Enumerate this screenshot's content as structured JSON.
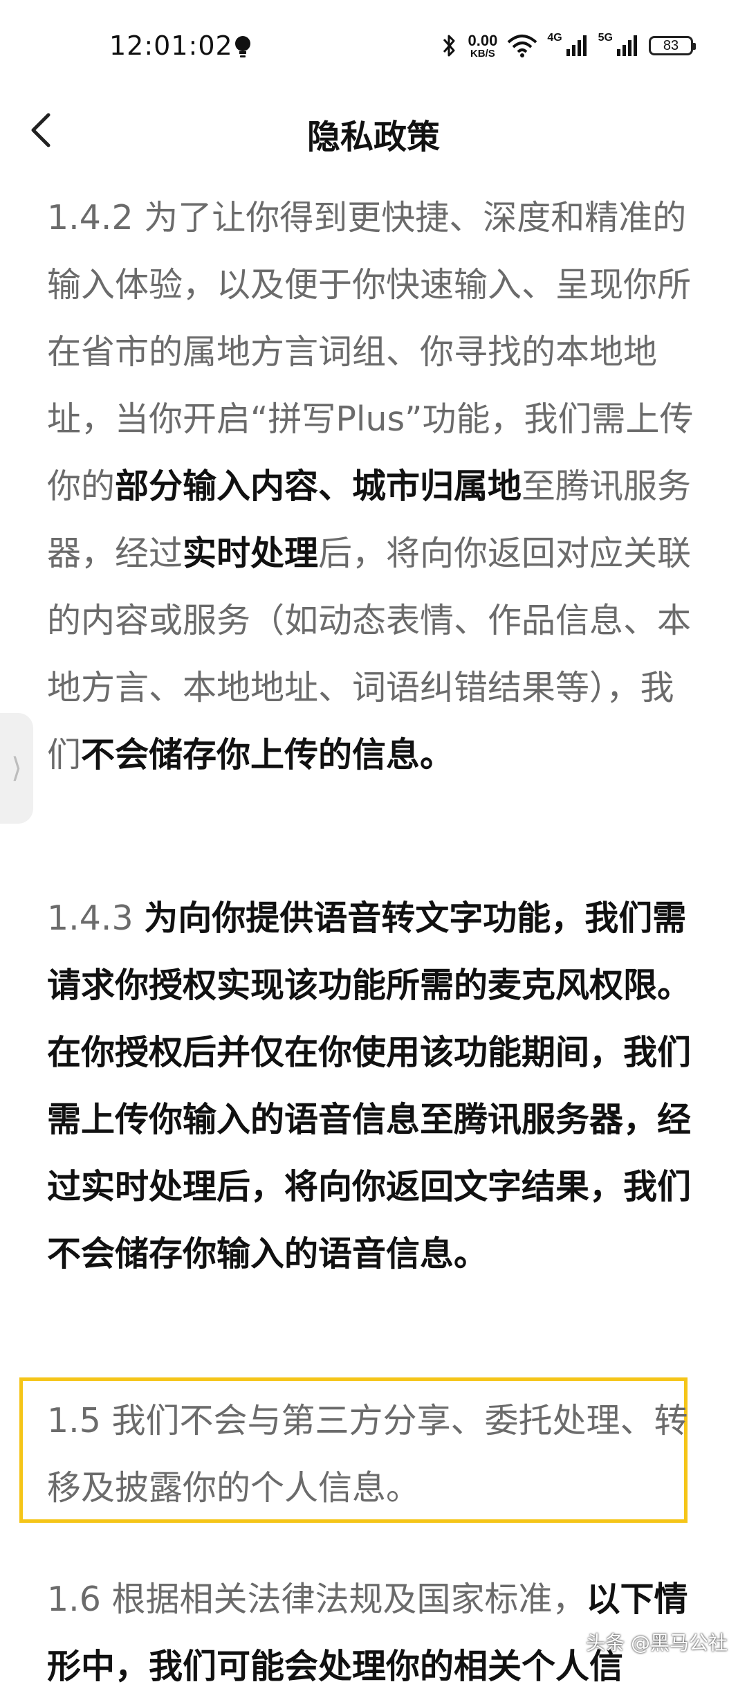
{
  "status_bar": {
    "time": "12:01:02",
    "net_speed_value": "0.00",
    "net_speed_unit": "KB/S",
    "sim1_label": "4G",
    "sim2_label": "5G",
    "battery": "83"
  },
  "header": {
    "title": "隐私政策"
  },
  "sections": {
    "p1": {
      "a": "1.4.2 为了让你得到更快捷、深度和精准的输入体验，以及便于你快速输入、呈现你所在省市的属地方言词组、你寻找的本地地址，当你开启“拼写Plus”功能，我们需上传你的",
      "b1": "部分输入内容、城市归属地",
      "c": "至腾讯服务器，经过",
      "b2": "实时处理",
      "d": "后，将向你返回对应关联的内容或服务（如动态表情、作品信息、本地方言、本地地址、词语纠错结果等），我们",
      "b3": "不会储存你上传的信息",
      "e": "。"
    },
    "p2": {
      "a": "1.4.3 ",
      "b1": "为向你提供语音转文字功能，我们需请求你授权实现该功能所需的麦克风权限。在你授权后并仅在你使用该功能期间，我们需上传你输入的语音信息至腾讯服务器，经过实时处理后，将向你返回文字结果，我们不会储存你输入的语音信息。"
    },
    "p3": {
      "a": "1.5 我们不会与第三方分享、委托处理、转移及披露你的个人信息。"
    },
    "p4": {
      "a": "1.6 根据相关法律法规及国家标准，",
      "b1": "以下情形中，我们可能会处理你的相关个人信"
    }
  },
  "side_handle": {
    "glyph": "⟩"
  },
  "watermark": "头条 @黑马公社",
  "colors": {
    "highlight_border": "#f5c518",
    "body_text": "#6b6b6b",
    "bold_text": "#111111"
  }
}
